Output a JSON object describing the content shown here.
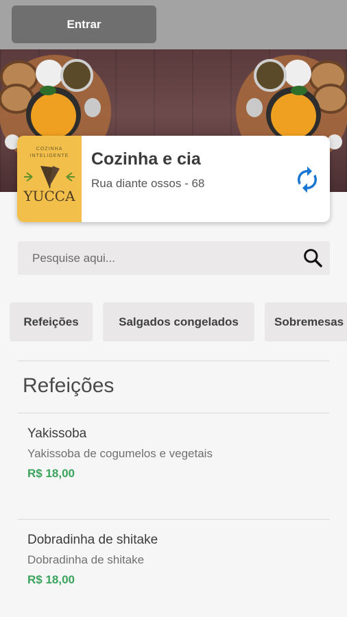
{
  "header": {
    "login_label": "Entrar"
  },
  "store": {
    "name": "Cozinha e cia",
    "address": "Rua diante ossos - 68",
    "logo": {
      "small_line_1": "COZINHA",
      "small_line_2": "INTELIGENTE",
      "brand": "YUCCA"
    }
  },
  "search": {
    "placeholder": "Pesquise aqui..."
  },
  "categories": [
    "Refeições",
    "Salgados congelados",
    "Sobremesas"
  ],
  "section": {
    "title": "Refeições"
  },
  "items": [
    {
      "name": "Yakissoba",
      "description": "Yakissoba de cogumelos e vegetais",
      "price": "R$ 18,00"
    },
    {
      "name": "Dobradinha de shitake",
      "description": "Dobradinha de shitake",
      "price": "R$ 18,00"
    }
  ],
  "colors": {
    "accent": "#1976d2",
    "price": "#3aa35c",
    "topbar": "#a3a3a3",
    "button": "#6f6f6f",
    "logo_bg": "#f2c04a"
  },
  "icons": {
    "refresh": "refresh-icon",
    "search": "search-icon"
  }
}
